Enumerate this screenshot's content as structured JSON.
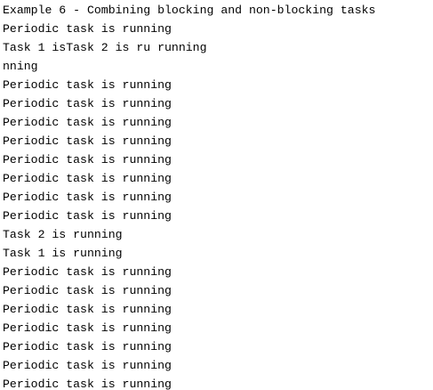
{
  "console": {
    "lines": [
      "Example 6 - Combining blocking and non-blocking tasks",
      "Periodic task is running",
      "Task 1 isTask 2 is ru running",
      "nning",
      "Periodic task is running",
      "Periodic task is running",
      "Periodic task is running",
      "Periodic task is running",
      "Periodic task is running",
      "Periodic task is running",
      "Periodic task is running",
      "Periodic task is running",
      "Task 2 is running",
      "Task 1 is running",
      "Periodic task is running",
      "Periodic task is running",
      "Periodic task is running",
      "Periodic task is running",
      "Periodic task is running",
      "Periodic task is running",
      "Periodic task is running"
    ]
  }
}
